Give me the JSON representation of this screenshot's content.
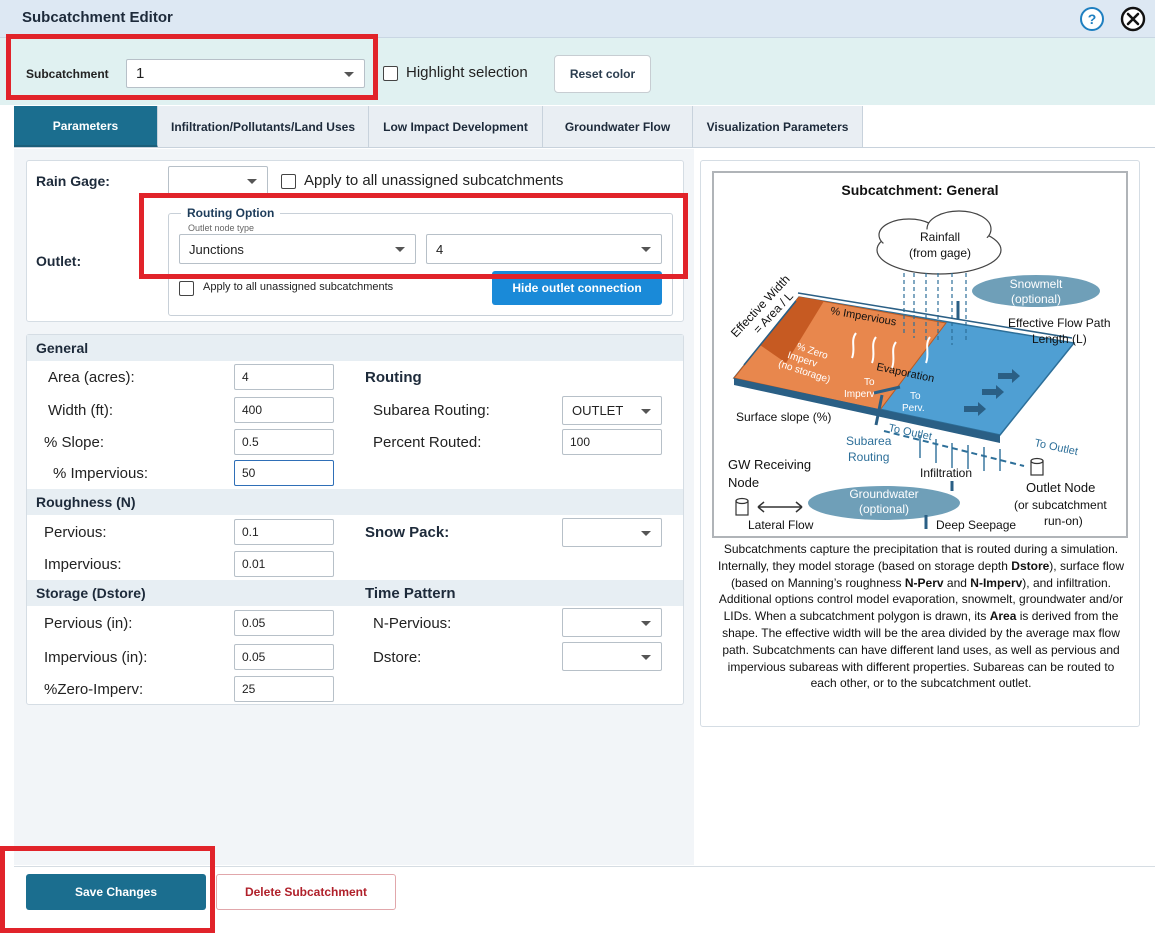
{
  "window": {
    "title": "Subcatchment Editor",
    "help_label": "?"
  },
  "selector": {
    "label": "Subcatchment",
    "value": "1",
    "highlight_label": "Highlight selection",
    "reset_label": "Reset color"
  },
  "tabs": [
    {
      "label": "Parameters",
      "active": true
    },
    {
      "label": "Infiltration/Pollutants/Land Uses",
      "active": false
    },
    {
      "label": "Low Impact Development",
      "active": false
    },
    {
      "label": "Groundwater Flow",
      "active": false
    },
    {
      "label": "Visualization Parameters",
      "active": false
    }
  ],
  "rain_gage": {
    "label": "Rain Gage:",
    "value": "",
    "apply_label": "Apply to all unassigned subcatchments"
  },
  "outlet": {
    "label": "Outlet:",
    "routing_legend": "Routing Option",
    "node_type_caption": "Outlet node type",
    "node_type_value": "Junctions",
    "node_value": "4",
    "apply_label": "Apply to all unassigned subcatchments",
    "hide_button": "Hide outlet connection"
  },
  "general": {
    "header": "General",
    "area_label": "Area (acres):",
    "area_value": "4",
    "width_label": "Width (ft):",
    "width_value": "400",
    "slope_label": "% Slope:",
    "slope_value": "0.5",
    "imperv_label": "% Impervious:",
    "imperv_value": "50",
    "routing_header": "Routing",
    "subarea_label": "Subarea Routing:",
    "subarea_value": "OUTLET",
    "percent_label": "Percent Routed:",
    "percent_value": "100"
  },
  "roughness": {
    "header": "Roughness (N)",
    "pervious_label": "Pervious:",
    "pervious_value": "0.1",
    "impervious_label": "Impervious:",
    "impervious_value": "0.01",
    "snowpack_label": "Snow Pack:",
    "snowpack_value": ""
  },
  "storage": {
    "header": "Storage (Dstore)",
    "pervious_label": "Pervious (in):",
    "pervious_value": "0.05",
    "impervious_label": "Impervious (in):",
    "impervious_value": "0.05",
    "zero_label": "%Zero-Imperv:",
    "zero_value": "25",
    "time_header": "Time Pattern",
    "npervious_label": "N-Pervious:",
    "npervious_value": "",
    "dstore_label": "Dstore:",
    "dstore_value": ""
  },
  "diagram": {
    "title": "Subcatchment: General",
    "rainfall": "Rainfall",
    "rainfall_sub": "(from gage)",
    "snowmelt": "Snowmelt",
    "snowmelt_sub": "(optional)",
    "effective_width": "Effective Width",
    "area_l": "= Area / L",
    "flow_path": "Effective Flow Path",
    "flow_length": "Length (L)",
    "pct_impervious": "% Impervious",
    "pct_zero": "% Zero",
    "imperv_word": "Imperv",
    "no_storage": "(no storage)",
    "evaporation": "Evaporation",
    "to_word": "To",
    "to_imperv": "Imperv",
    "to_perv": "Perv.",
    "surface_slope": "Surface slope (%)",
    "to_outlet": "To Outlet",
    "subarea": "Subarea",
    "routing": "Routing",
    "infiltration": "Infiltration",
    "gw_receiving": "GW Receiving",
    "node": "Node",
    "groundwater": "Groundwater",
    "groundwater_sub": "(optional)",
    "outlet_node": "Outlet Node",
    "or_subcatchment": "(or subcatchment",
    "run_on": "run-on)",
    "lateral_flow": "Lateral Flow",
    "deep_seepage": "Deep Seepage",
    "colors": {
      "impervious": "#e8874d",
      "pervious": "#4f9fd3",
      "cloud_fill": "#ffffff",
      "ellipse": "#6f9fb8"
    }
  },
  "info": {
    "p1": "Subcatchments capture the precipitation that is routed during a simulation. Internally, they model storage (based on storage depth ",
    "dstore": "Dstore",
    "p2": "), surface flow (based on Manning’s roughness ",
    "nperv": "N-Perv",
    "and": " and ",
    "nimperv": "N-Imperv",
    "p3": "), and infiltration. Additional options control model evaporation, snowmelt, groundwater and/or LIDs. When a subcatchment polygon is drawn, its ",
    "area": "Area",
    "p4": " is derived from the shape. The effective width will be the area divided by the average max flow path. Subcatchments can have different land uses, as well as pervious and impervious subareas with different properties. Subareas can be routed to each other, or to the subcatchment outlet."
  },
  "footer": {
    "save": "Save Changes",
    "delete": "Delete Subcatchment"
  },
  "colors": {
    "primary": "#1b6e8f",
    "accent_blue": "#1a8ad8",
    "highlight_red": "#e1232a",
    "danger": "#b0202a"
  }
}
